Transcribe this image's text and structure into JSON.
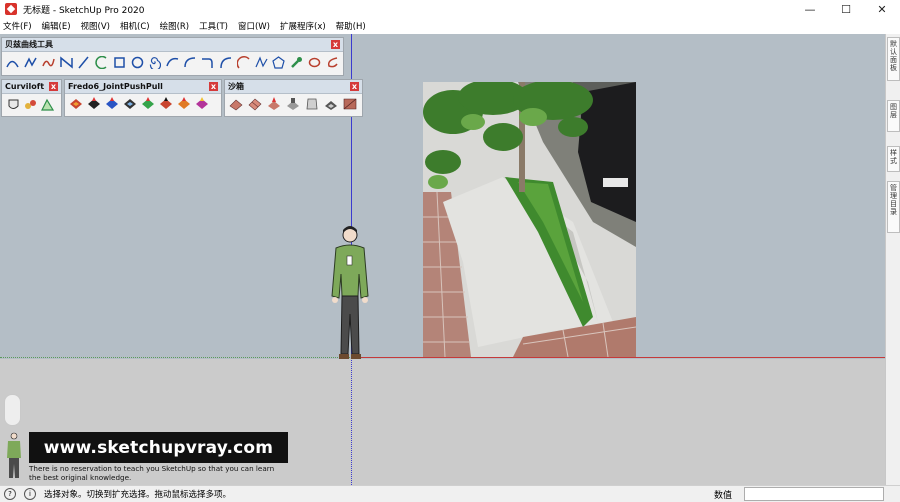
{
  "window": {
    "title": "无标题 - SketchUp Pro 2020",
    "minimize": "—",
    "maximize": "☐",
    "close": "✕"
  },
  "menu": [
    "文件(F)",
    "编辑(E)",
    "视图(V)",
    "相机(C)",
    "绘图(R)",
    "工具(T)",
    "窗口(W)",
    "扩展程序(x)",
    "帮助(H)"
  ],
  "toolbars": {
    "bezier": {
      "title": "贝兹曲线工具"
    },
    "curviloft": {
      "title": "Curviloft"
    },
    "fredo": {
      "title": "Fredo6_JointPushPull"
    },
    "sandbox": {
      "title": "沙箱"
    },
    "close_glyph": "x"
  },
  "dock_tabs": [
    "默认面板",
    "图层",
    "样式",
    "管理目录"
  ],
  "watermark": {
    "url": "www.sketchupvray.com",
    "line1": "There is no reservation to teach you SketchUp so that you can learn",
    "line2": "the best original knowledge."
  },
  "status": {
    "message": "选择对象。切换到扩充选择。拖动鼠标选择多项。",
    "value_label": "数值",
    "value": ""
  },
  "colors": {
    "sky": "#b4bec6",
    "ground": "#cbcbcb",
    "red_axis": "#c53a3a",
    "blue_axis": "#3b3bcf"
  }
}
